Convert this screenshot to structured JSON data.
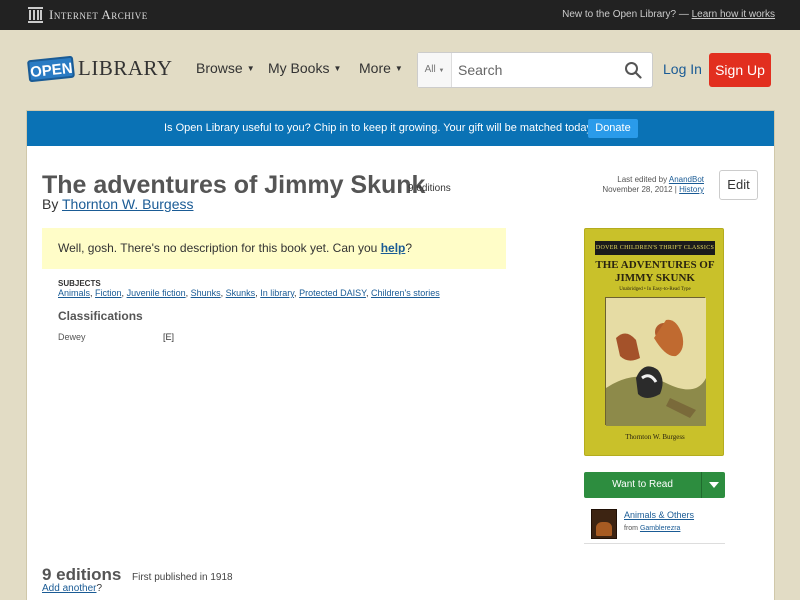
{
  "topbar": {
    "ia_logo_text": "Internet Archive",
    "new_text": "New to the Open Library? — ",
    "learn_link": "Learn how it works"
  },
  "header": {
    "logo_badge": "OPEN",
    "logo_word": "LIBRARY",
    "nav": [
      "Browse",
      "My Books",
      "More"
    ],
    "search_scope": "All",
    "search_placeholder": "Search",
    "login": "Log In",
    "signup": "Sign Up"
  },
  "donate": {
    "text": "Is Open Library useful to you? Chip in to keep it growing. Your gift will be matched today!",
    "button": "Donate"
  },
  "book": {
    "title": "The adventures of Jimmy Skunk",
    "editions_badge": "9 editions",
    "by": "By ",
    "author": "Thornton W. Burgess",
    "last_edited_prefix": "Last edited by ",
    "last_edited_by": "AnandBot",
    "last_edited_date": "November 28, 2012 | ",
    "history": "History",
    "edit_button": "Edit",
    "description_prefix": "Well, gosh. There's no description for this book yet. Can you ",
    "description_link": "help",
    "description_suffix": "?"
  },
  "subjects": {
    "label": "SUBJECTS",
    "items": [
      "Animals",
      "Fiction",
      "Juvenile fiction",
      "Shunks",
      "Skunks",
      "In library",
      "Protected DAISY",
      "Children's stories"
    ]
  },
  "classifications": {
    "heading": "Classifications",
    "dewey_label": "Dewey",
    "dewey_value": "[E]"
  },
  "cover": {
    "band": "DOVER CHILDREN'S THRIFT CLASSICS",
    "title": "THE ADVENTURES OF JIMMY SKUNK",
    "subtitle": "Unabridged • In Easy-to-Read Type",
    "author": "Thornton W. Burgess"
  },
  "sidebar": {
    "want_to_read": "Want to Read",
    "list_title": "Animals & Others",
    "list_from_prefix": "from ",
    "list_from_user": "Gamblerezra"
  },
  "editions": {
    "heading": "9 editions",
    "first_published": "First published in 1918",
    "add_another_link": "Add another",
    "add_another_suffix": "?"
  }
}
